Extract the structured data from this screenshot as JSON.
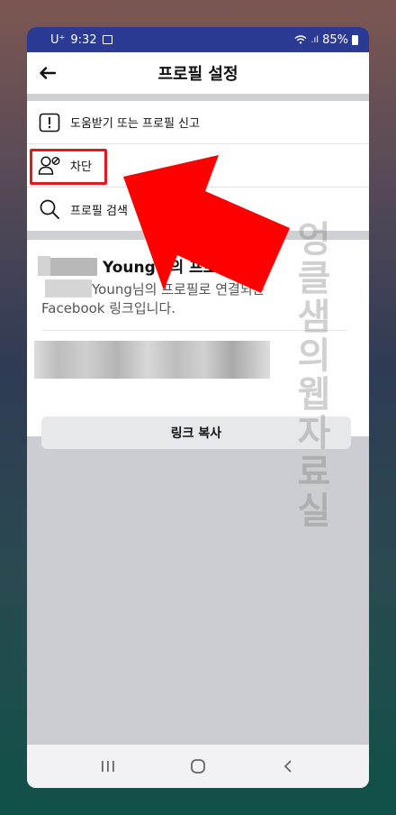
{
  "status_bar": {
    "carrier": "U⁺",
    "time": "9:32",
    "signal": ".ıl",
    "battery": "85%"
  },
  "app_bar": {
    "title": "프로필 설정"
  },
  "menu": {
    "items": [
      {
        "label": "도움받기 또는 프로필 신고",
        "icon": "report-icon"
      },
      {
        "label": "차단",
        "icon": "block-user-icon"
      },
      {
        "label": "프로필 검색",
        "icon": "search-icon"
      }
    ]
  },
  "profile_link_card": {
    "title": "Young님의 프로필 링크",
    "description": "Young님의 프로필로 연결되는 Facebook 링크입니다.",
    "copy_button": "링크 복사"
  },
  "watermark": [
    "엉",
    "클",
    "샘",
    "의",
    "웹",
    "자",
    "료",
    "실"
  ],
  "colors": {
    "status_bar": "#2b3a93",
    "highlight": "#e01b1b",
    "arrow": "#ff0000"
  }
}
